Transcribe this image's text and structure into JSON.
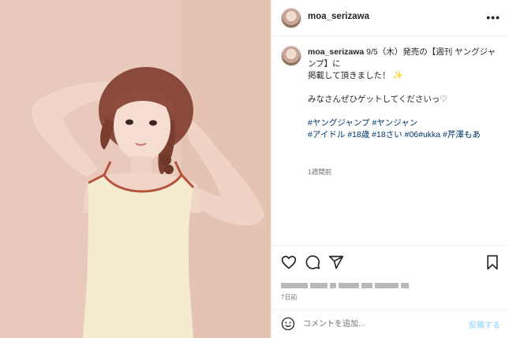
{
  "post": {
    "username": "moa_serizawa",
    "more_icon": "more-horizontal-icon",
    "caption": {
      "username": "moa_serizawa",
      "line1": " 9/5（木）発売の【週刊 ヤングジャンプ】に\n掲載して頂きました！",
      "sparkle": "✨",
      "line2": "みなさんぜひゲットしてくださいっ♡",
      "hashtags": "#ヤングジャンプ #ヤンジャン\n#アイドル #18歳 #18さい #06#ukka #芹澤もあ",
      "time_ago": "1週間前"
    },
    "actions": {
      "like_icon": "heart-icon",
      "comment_icon": "comment-icon",
      "share_icon": "send-icon",
      "save_icon": "bookmark-icon"
    },
    "posted": "7日前",
    "comment": {
      "placeholder": "コメントを追加...",
      "post_label": "投稿する",
      "emoji_icon": "smiley-icon"
    }
  }
}
